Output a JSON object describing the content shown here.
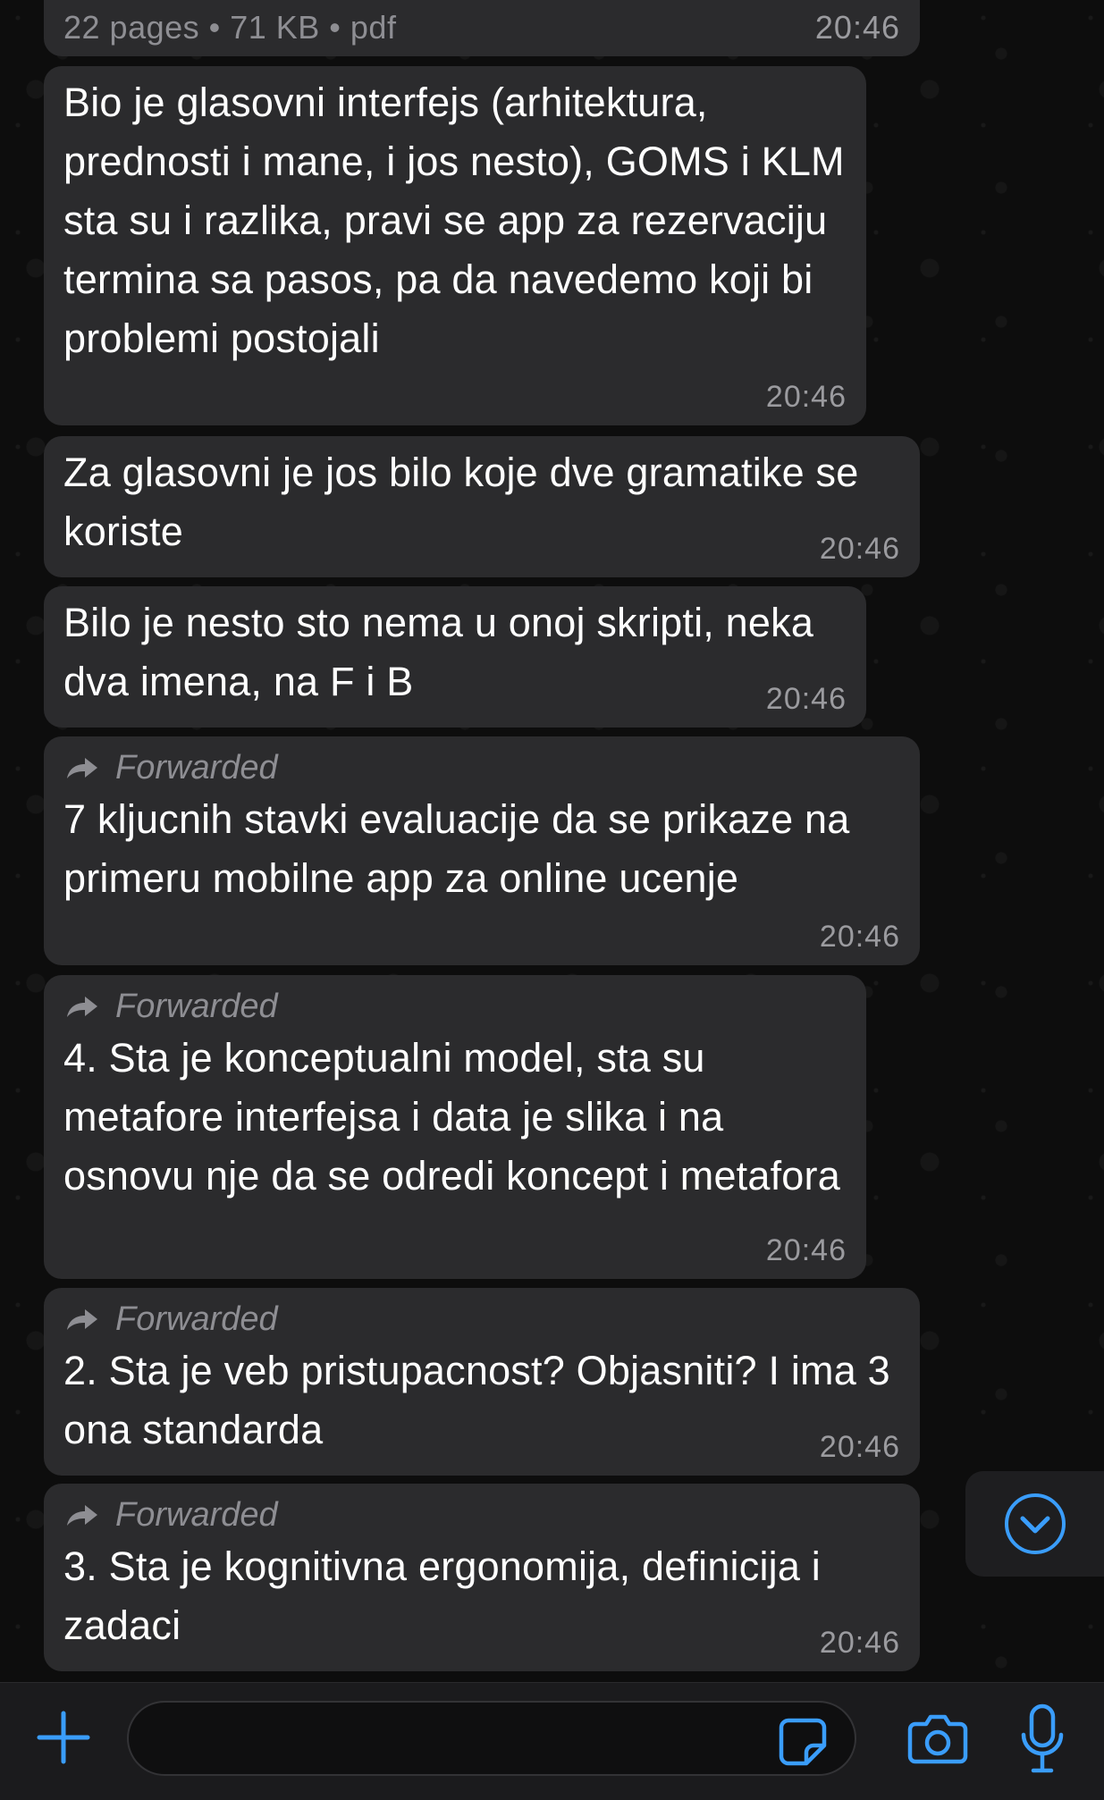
{
  "colors": {
    "accent": "#3a9dfb",
    "bubble": "#2b2b2d",
    "meta_text": "#9b9b9f"
  },
  "document": {
    "meta": "22 pages • 71 KB • pdf",
    "time": "20:46"
  },
  "messages": [
    {
      "forwarded": false,
      "text": "Bio je glasovni interfejs (arhitektura, prednosti i mane, i jos nesto), GOMS i KLM sta su i razlika, pravi se app za rezervaciju termina sa pasos, pa da navedemo koji bi problemi postojali",
      "time": "20:46"
    },
    {
      "forwarded": false,
      "text": "Za glasovni je jos bilo koje dve gramatike se koriste",
      "time": "20:46"
    },
    {
      "forwarded": false,
      "text": "Bilo je nesto sto nema u onoj skripti, neka dva imena, na F i B",
      "time": "20:46"
    },
    {
      "forwarded": true,
      "forwarded_label": "Forwarded",
      "text": "7 kljucnih stavki evaluacije da se prikaze na primeru mobilne app za online ucenje",
      "time": "20:46"
    },
    {
      "forwarded": true,
      "forwarded_label": "Forwarded",
      "text": "4. Sta je konceptualni model, sta su metafore interfejsa i data je slika i na osnovu nje da se odredi koncept i metafora",
      "time": "20:46"
    },
    {
      "forwarded": true,
      "forwarded_label": "Forwarded",
      "text": "2. Sta je veb pristupacnost? Objasniti? I ima 3 ona standarda",
      "time": "20:46"
    },
    {
      "forwarded": true,
      "forwarded_label": "Forwarded",
      "text": "3. Sta je kognitivna ergonomija, definicija i zadaci",
      "time": "20:46"
    }
  ],
  "input_bar": {
    "placeholder": "",
    "value": ""
  },
  "icons": {
    "add": "plus-icon",
    "sticker": "sticker-icon",
    "camera": "camera-icon",
    "mic": "microphone-icon",
    "scroll": "chevron-down-circle-icon",
    "forwarded": "forward-arrow-icon"
  }
}
